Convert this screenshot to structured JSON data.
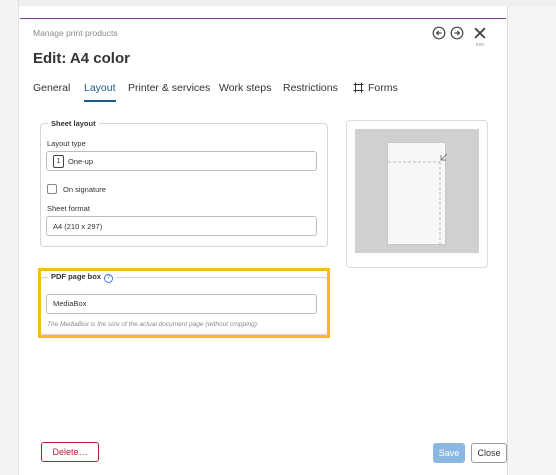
{
  "header": {
    "subtitle": "Manage print products",
    "title": "Edit: A4 color",
    "esc_label": "esc"
  },
  "tabs": [
    {
      "label": "General"
    },
    {
      "label": "Layout",
      "active": true
    },
    {
      "label": "Printer & services"
    },
    {
      "label": "Work steps"
    },
    {
      "label": "Restrictions"
    },
    {
      "label": "Forms",
      "icon": "forms-icon"
    }
  ],
  "sheet_layout": {
    "legend": "Sheet layout",
    "layout_type_label": "Layout type",
    "layout_type_badge": "1",
    "layout_type_value": "One-up",
    "on_signature_label": "On signature",
    "on_signature_checked": false,
    "sheet_format_label": "Sheet format",
    "sheet_format_value": "A4 (210 x 297)"
  },
  "pdf_page_box": {
    "legend": "PDF page box",
    "help_glyph": "?",
    "value": "MediaBox",
    "help_text": "The MediaBox is the size of the actual document page (without cropping)."
  },
  "buttons": {
    "delete": "Delete…",
    "save": "Save",
    "close": "Close"
  },
  "colors": {
    "accent": "#7a3f8f",
    "active_tab": "#1e5b8a",
    "highlight": "#f5bd1c",
    "delete": "#b0213a",
    "save": "#8ab8e2"
  }
}
